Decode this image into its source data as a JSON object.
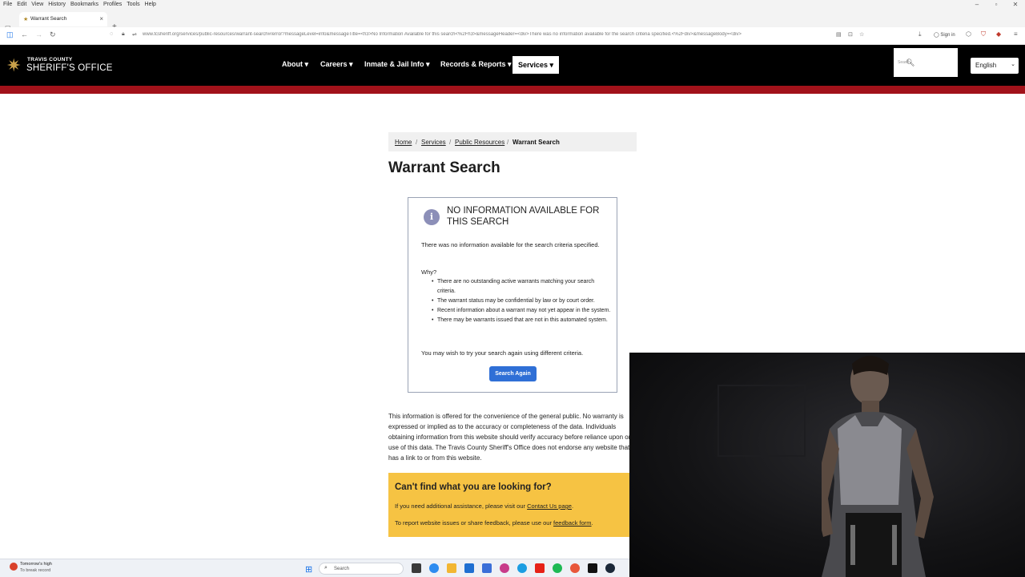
{
  "browser": {
    "menu": [
      "File",
      "Edit",
      "View",
      "History",
      "Bookmarks",
      "Profiles",
      "Tools",
      "Help"
    ],
    "tab_title": "Warrant Search",
    "url": "www.tcsheriff.org/services/public-resources/warrant-search#/error?messageLevel=info&messageTitle=<h3>No Information Available for this search<%2Fh3>&messageHeader=<div>There was no information available for the search criteria specified.<%2Fdiv>&messageBody=<div>",
    "signin_label": "Sign in"
  },
  "header": {
    "logo_small": "TRAVIS COUNTY",
    "logo_big": "SHERIFF'S OFFICE",
    "nav": {
      "about": "About ▾",
      "careers": "Careers ▾",
      "inmate": "Inmate & Jail Info ▾",
      "records": "Records & Reports ▾",
      "services": "Services ▾"
    },
    "search_placeholder": "Search",
    "language": "English"
  },
  "breadcrumb": {
    "home": "Home",
    "services": "Services",
    "public_resources": "Public Resources",
    "current": "Warrant Search",
    "sep": "/"
  },
  "page_title": "Warrant Search",
  "message": {
    "icon": "i",
    "title": "No Information Available for this search",
    "text": "There was no information available for the search criteria specified.",
    "why": "Why?",
    "reasons": [
      "There are no outstanding active warrants matching your search criteria.",
      "The warrant status may be confidential by law or by court order.",
      "Recent information about a warrant may not yet appear in the system.",
      "There may be warrants issued that are not in this automated system."
    ],
    "try_again": "You may wish to try your search again using different criteria.",
    "button": "Search Again"
  },
  "disclaimer": "This information is offered for the convenience of the general public. No warranty is expressed or implied as to the accuracy or completeness of the data. Individuals obtaining information from this website should verify accuracy before reliance upon or use of this data. The Travis County Sheriff's Office does not endorse any website that has a link to or from this website.",
  "help": {
    "title": "Can't find what you are looking for?",
    "line1_pre": "If you need additional assistance, please visit our ",
    "line1_link": "Contact Us page",
    "line1_post": ".",
    "line2_pre": "To report website issues or share feedback, please use our ",
    "line2_link": "feedback form",
    "line2_post": "."
  },
  "taskbar": {
    "weather_line1": "Tomorrow's high",
    "weather_line2": "To break record",
    "search_label": "Search"
  },
  "colors": {
    "header_bg": "#000000",
    "red_bar": "#a1121a",
    "button_blue": "#2f6fd6",
    "help_yellow": "#f6c343",
    "info_icon": "#8c8fb8",
    "logo_gold": "#c9a14a"
  }
}
